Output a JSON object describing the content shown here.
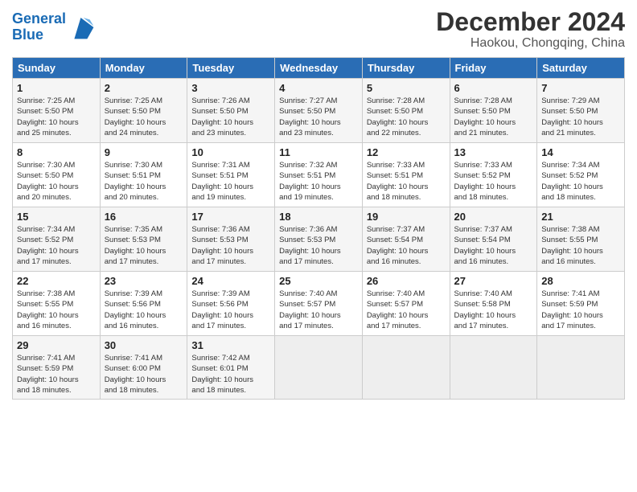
{
  "logo": {
    "text_general": "General",
    "text_blue": "Blue"
  },
  "title": "December 2024",
  "subtitle": "Haokou, Chongqing, China",
  "headers": [
    "Sunday",
    "Monday",
    "Tuesday",
    "Wednesday",
    "Thursday",
    "Friday",
    "Saturday"
  ],
  "weeks": [
    [
      {
        "day": "1",
        "info": "Sunrise: 7:25 AM\nSunset: 5:50 PM\nDaylight: 10 hours\nand 25 minutes."
      },
      {
        "day": "2",
        "info": "Sunrise: 7:25 AM\nSunset: 5:50 PM\nDaylight: 10 hours\nand 24 minutes."
      },
      {
        "day": "3",
        "info": "Sunrise: 7:26 AM\nSunset: 5:50 PM\nDaylight: 10 hours\nand 23 minutes."
      },
      {
        "day": "4",
        "info": "Sunrise: 7:27 AM\nSunset: 5:50 PM\nDaylight: 10 hours\nand 23 minutes."
      },
      {
        "day": "5",
        "info": "Sunrise: 7:28 AM\nSunset: 5:50 PM\nDaylight: 10 hours\nand 22 minutes."
      },
      {
        "day": "6",
        "info": "Sunrise: 7:28 AM\nSunset: 5:50 PM\nDaylight: 10 hours\nand 21 minutes."
      },
      {
        "day": "7",
        "info": "Sunrise: 7:29 AM\nSunset: 5:50 PM\nDaylight: 10 hours\nand 21 minutes."
      }
    ],
    [
      {
        "day": "8",
        "info": "Sunrise: 7:30 AM\nSunset: 5:50 PM\nDaylight: 10 hours\nand 20 minutes."
      },
      {
        "day": "9",
        "info": "Sunrise: 7:30 AM\nSunset: 5:51 PM\nDaylight: 10 hours\nand 20 minutes."
      },
      {
        "day": "10",
        "info": "Sunrise: 7:31 AM\nSunset: 5:51 PM\nDaylight: 10 hours\nand 19 minutes."
      },
      {
        "day": "11",
        "info": "Sunrise: 7:32 AM\nSunset: 5:51 PM\nDaylight: 10 hours\nand 19 minutes."
      },
      {
        "day": "12",
        "info": "Sunrise: 7:33 AM\nSunset: 5:51 PM\nDaylight: 10 hours\nand 18 minutes."
      },
      {
        "day": "13",
        "info": "Sunrise: 7:33 AM\nSunset: 5:52 PM\nDaylight: 10 hours\nand 18 minutes."
      },
      {
        "day": "14",
        "info": "Sunrise: 7:34 AM\nSunset: 5:52 PM\nDaylight: 10 hours\nand 18 minutes."
      }
    ],
    [
      {
        "day": "15",
        "info": "Sunrise: 7:34 AM\nSunset: 5:52 PM\nDaylight: 10 hours\nand 17 minutes."
      },
      {
        "day": "16",
        "info": "Sunrise: 7:35 AM\nSunset: 5:53 PM\nDaylight: 10 hours\nand 17 minutes."
      },
      {
        "day": "17",
        "info": "Sunrise: 7:36 AM\nSunset: 5:53 PM\nDaylight: 10 hours\nand 17 minutes."
      },
      {
        "day": "18",
        "info": "Sunrise: 7:36 AM\nSunset: 5:53 PM\nDaylight: 10 hours\nand 17 minutes."
      },
      {
        "day": "19",
        "info": "Sunrise: 7:37 AM\nSunset: 5:54 PM\nDaylight: 10 hours\nand 16 minutes."
      },
      {
        "day": "20",
        "info": "Sunrise: 7:37 AM\nSunset: 5:54 PM\nDaylight: 10 hours\nand 16 minutes."
      },
      {
        "day": "21",
        "info": "Sunrise: 7:38 AM\nSunset: 5:55 PM\nDaylight: 10 hours\nand 16 minutes."
      }
    ],
    [
      {
        "day": "22",
        "info": "Sunrise: 7:38 AM\nSunset: 5:55 PM\nDaylight: 10 hours\nand 16 minutes."
      },
      {
        "day": "23",
        "info": "Sunrise: 7:39 AM\nSunset: 5:56 PM\nDaylight: 10 hours\nand 16 minutes."
      },
      {
        "day": "24",
        "info": "Sunrise: 7:39 AM\nSunset: 5:56 PM\nDaylight: 10 hours\nand 17 minutes."
      },
      {
        "day": "25",
        "info": "Sunrise: 7:40 AM\nSunset: 5:57 PM\nDaylight: 10 hours\nand 17 minutes."
      },
      {
        "day": "26",
        "info": "Sunrise: 7:40 AM\nSunset: 5:57 PM\nDaylight: 10 hours\nand 17 minutes."
      },
      {
        "day": "27",
        "info": "Sunrise: 7:40 AM\nSunset: 5:58 PM\nDaylight: 10 hours\nand 17 minutes."
      },
      {
        "day": "28",
        "info": "Sunrise: 7:41 AM\nSunset: 5:59 PM\nDaylight: 10 hours\nand 17 minutes."
      }
    ],
    [
      {
        "day": "29",
        "info": "Sunrise: 7:41 AM\nSunset: 5:59 PM\nDaylight: 10 hours\nand 18 minutes."
      },
      {
        "day": "30",
        "info": "Sunrise: 7:41 AM\nSunset: 6:00 PM\nDaylight: 10 hours\nand 18 minutes."
      },
      {
        "day": "31",
        "info": "Sunrise: 7:42 AM\nSunset: 6:01 PM\nDaylight: 10 hours\nand 18 minutes."
      },
      {
        "day": "",
        "info": ""
      },
      {
        "day": "",
        "info": ""
      },
      {
        "day": "",
        "info": ""
      },
      {
        "day": "",
        "info": ""
      }
    ]
  ]
}
